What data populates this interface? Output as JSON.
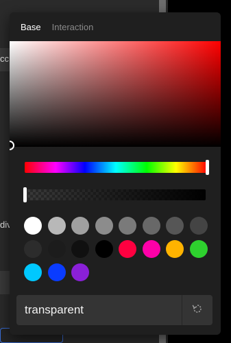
{
  "background": {
    "partial_text_1": "cc",
    "partial_text_2": "div"
  },
  "tabs": [
    {
      "label": "Base",
      "active": true
    },
    {
      "label": "Interaction",
      "active": false
    }
  ],
  "picker": {
    "base_hue": "#ff0000",
    "hue_position": 1.0,
    "alpha_position": 0.0
  },
  "swatches": [
    "#ffffff",
    "#b8b8b8",
    "#a0a0a0",
    "#8c8c8c",
    "#7a7a7a",
    "#686868",
    "#565656",
    "#444444",
    "#2c2c2c",
    "#1c1c1c",
    "#101010",
    "#000000",
    "#ff0040",
    "#ff00a8",
    "#ffb300",
    "#2ed12e",
    "#00c8ff",
    "#0a3cff",
    "#8a20d8"
  ],
  "value": {
    "text": "transparent"
  },
  "icons": {
    "reset": "reset-icon"
  }
}
